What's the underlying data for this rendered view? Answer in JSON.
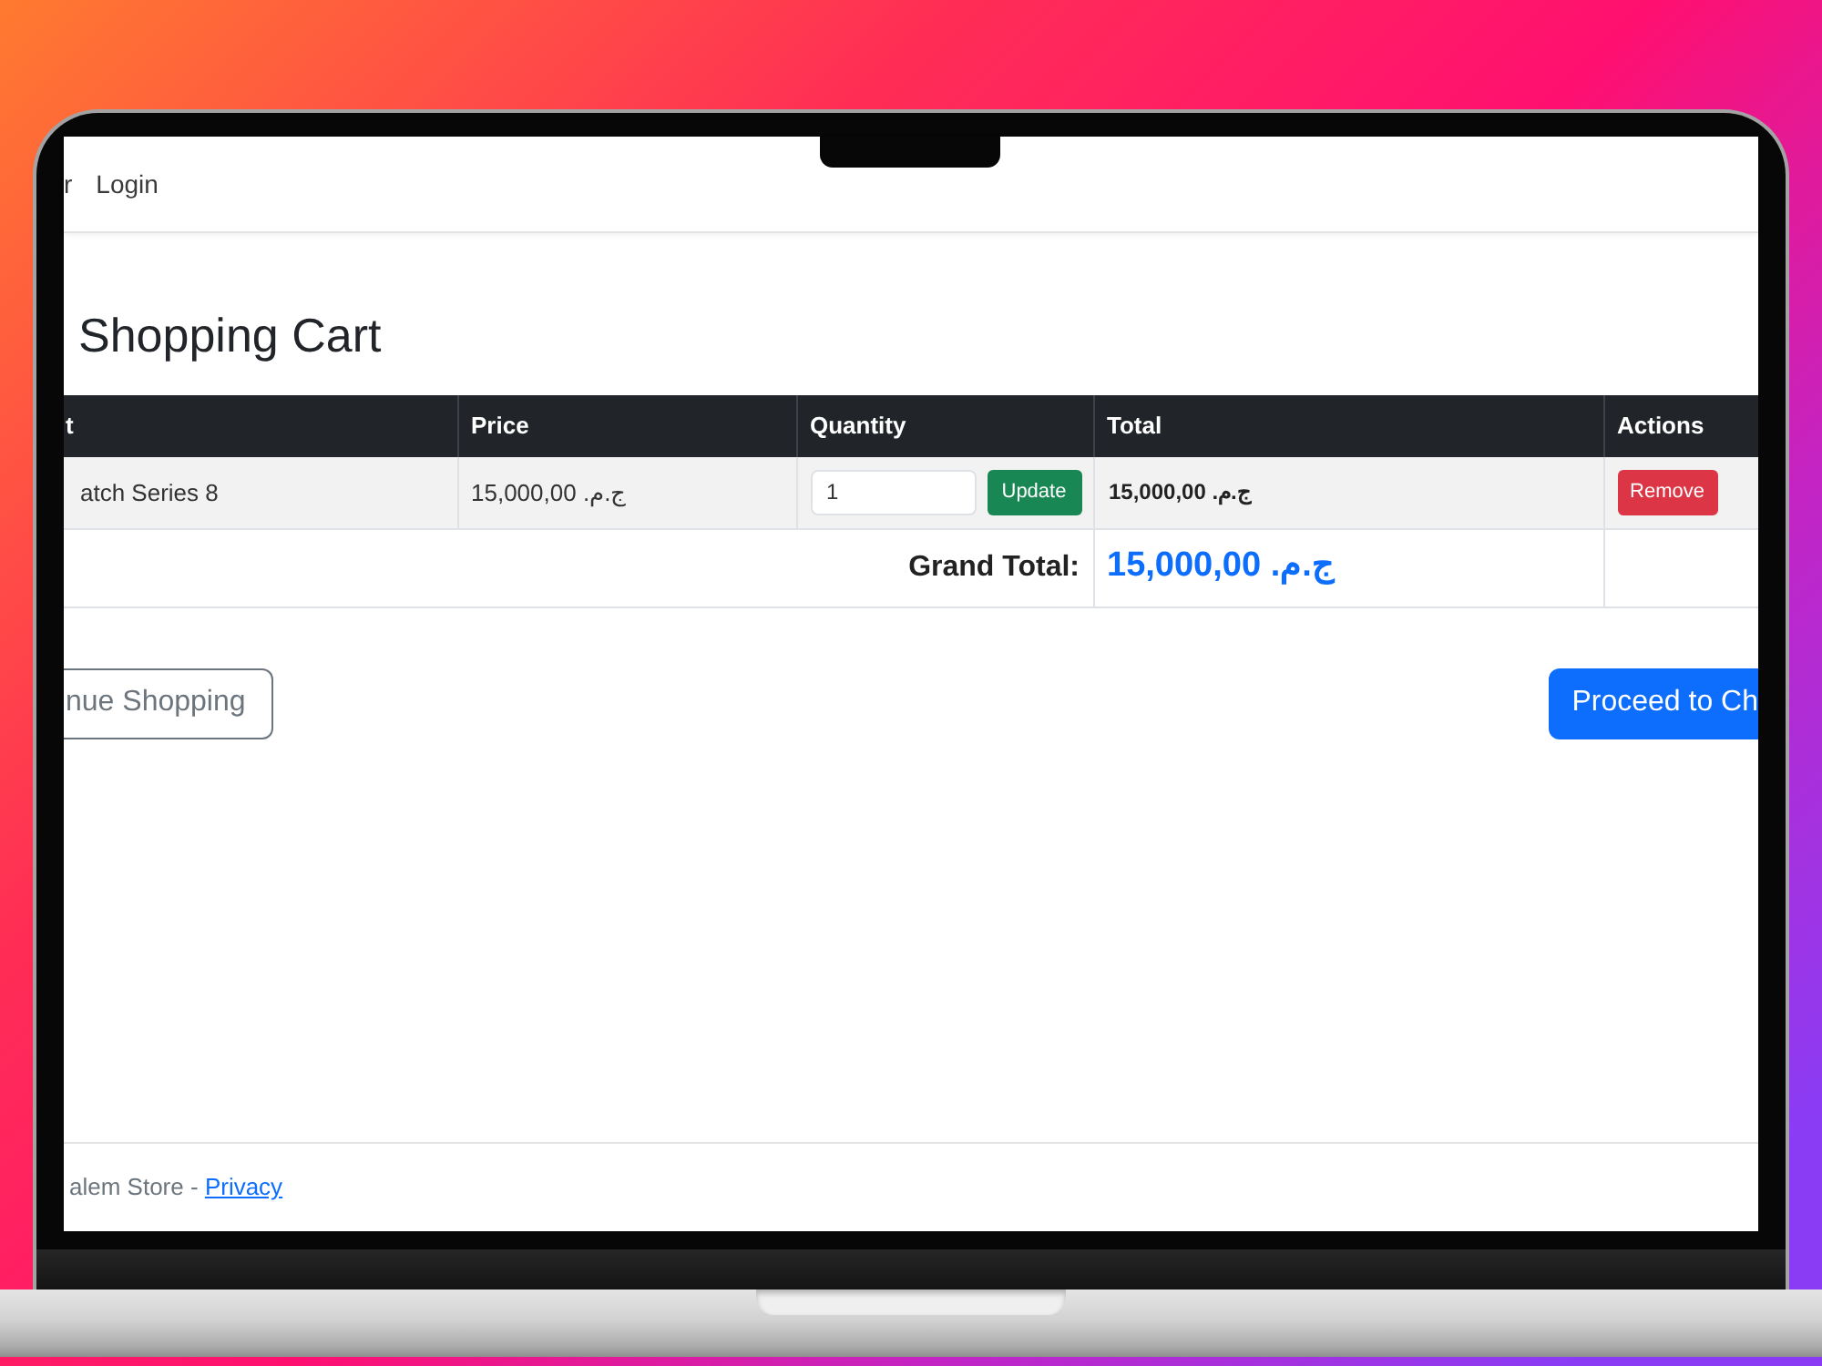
{
  "navbar": {
    "links": [
      {
        "label": "r"
      },
      {
        "label": "Login"
      }
    ]
  },
  "heading": "Shopping Cart",
  "table": {
    "columns": [
      "t",
      "Price",
      "Quantity",
      "Total",
      "Actions"
    ],
    "rows": [
      {
        "product": "atch Series 8",
        "price": "15,000,00 ج.م.‏",
        "quantity": "1",
        "update_button": "Update",
        "total": "15,000,00 ج.م.‏",
        "remove_button": "Remove"
      }
    ],
    "grand_total": {
      "label": "Grand Total:",
      "value": "15,000,00 ج.م.‏"
    }
  },
  "buttons": [
    {
      "label": "nue Shopping",
      "kind": "outline"
    },
    {
      "label": "Proceed to Ch",
      "kind": "primary"
    }
  ],
  "footer": {
    "text": "alem Store -",
    "link": "Privacy"
  }
}
